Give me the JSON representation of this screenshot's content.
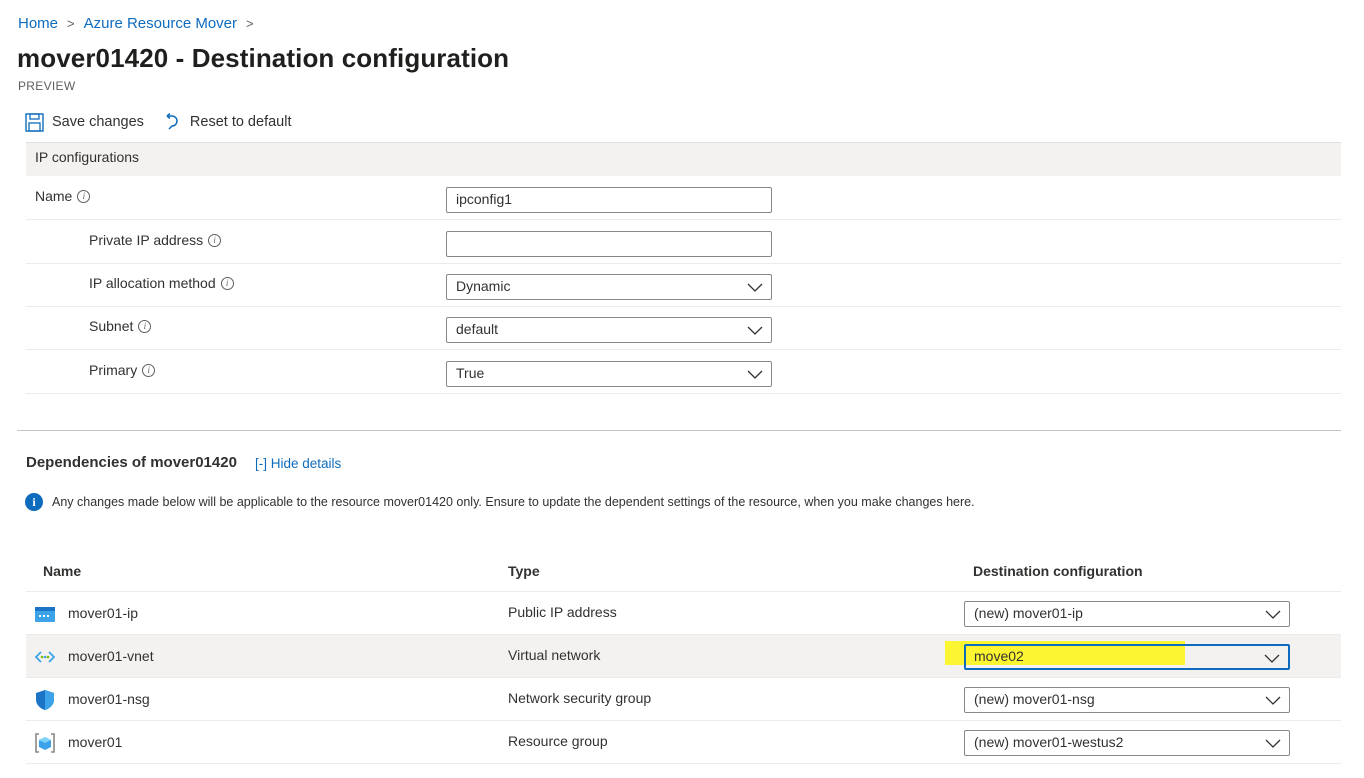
{
  "breadcrumb": {
    "home": "Home",
    "parent": "Azure Resource Mover",
    "sep": ">"
  },
  "page": {
    "title": "mover01420 - Destination configuration",
    "subtitle": "PREVIEW"
  },
  "toolbar": {
    "save_label": "Save changes",
    "reset_label": "Reset to default"
  },
  "ip_config": {
    "header": "IP configurations",
    "rows": [
      {
        "label": "Name",
        "value": "ipconfig1",
        "kind": "text"
      },
      {
        "label": "Private IP address",
        "value": "",
        "kind": "text"
      },
      {
        "label": "IP allocation method",
        "value": "Dynamic",
        "kind": "select"
      },
      {
        "label": "Subnet",
        "value": "default",
        "kind": "select"
      },
      {
        "label": "Primary",
        "value": "True",
        "kind": "select"
      }
    ]
  },
  "dependencies": {
    "title": "Dependencies of mover01420",
    "toggle_label": "[-] Hide details",
    "notice": "Any changes made below will be applicable to the resource mover01420 only. Ensure to update the dependent settings of the resource, when you make changes here.",
    "columns": {
      "name": "Name",
      "type": "Type",
      "dest": "Destination configuration"
    },
    "rows": [
      {
        "name": "mover01-ip",
        "type": "Public IP address",
        "dest": "(new) mover01-ip",
        "icon": "public-ip-icon"
      },
      {
        "name": "mover01-vnet",
        "type": "Virtual network",
        "dest": "move02",
        "icon": "virtual-network-icon"
      },
      {
        "name": "mover01-nsg",
        "type": "Network security group",
        "dest": "(new) mover01-nsg",
        "icon": "shield-icon"
      },
      {
        "name": "mover01",
        "type": "Resource group",
        "dest": "(new) mover01-westus2",
        "icon": "resource-group-icon"
      }
    ]
  },
  "colors": {
    "accent": "#0f6cbd",
    "highlight": "#fdf51c",
    "header_bg": "#f3f2f1"
  }
}
